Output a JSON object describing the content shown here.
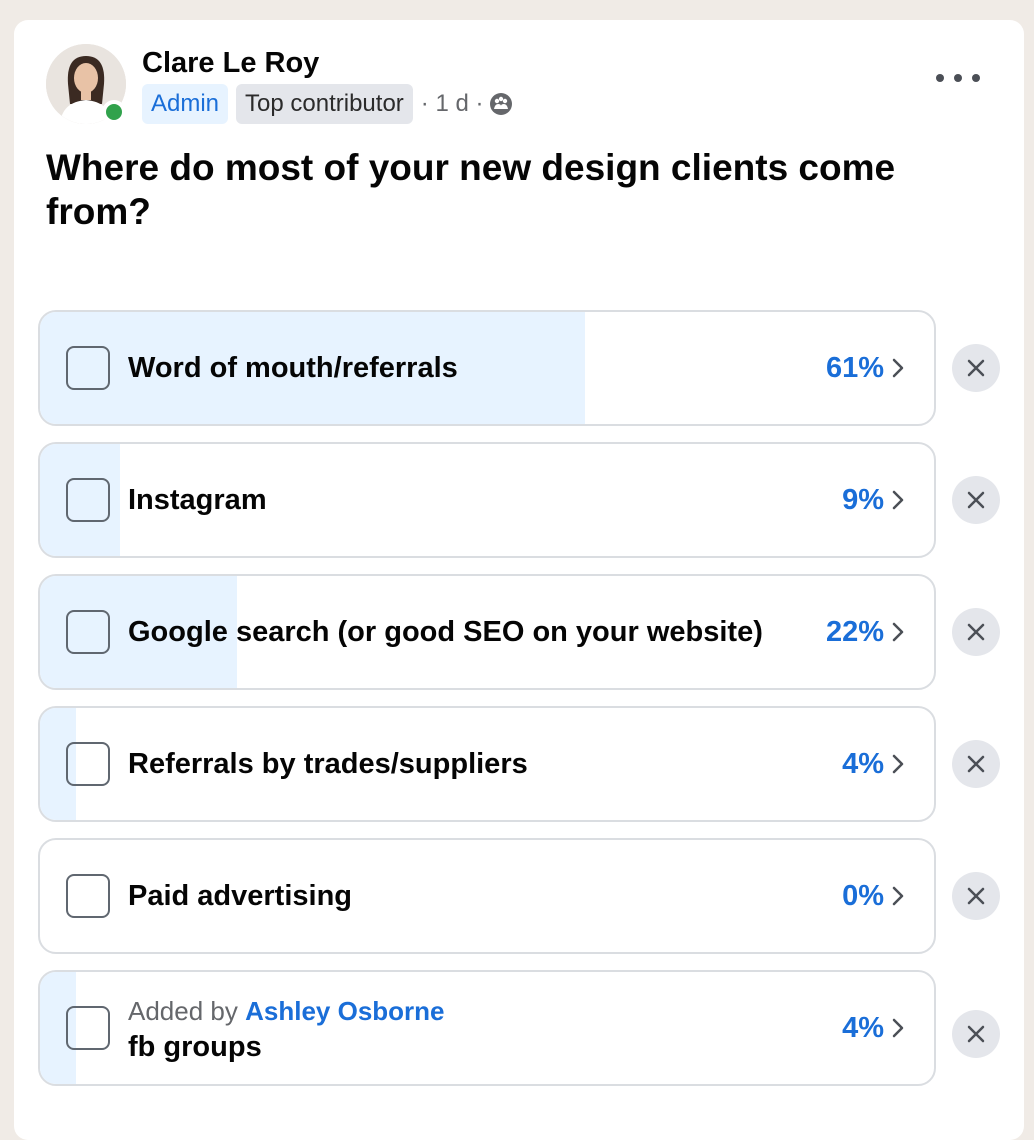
{
  "post": {
    "author": "Clare Le Roy",
    "badges": [
      "Admin",
      "Top contributor"
    ],
    "time": "· 1 d ·",
    "audience_icon": "group-icon",
    "question": "Where do most of your new design clients come from?"
  },
  "colors": {
    "accent": "#1a6ed8",
    "fill": "#e7f3ff",
    "online": "#31a24c",
    "card": "#ffffff",
    "page": "#f0ebe6"
  },
  "poll": {
    "options": [
      {
        "label": "Word of mouth/referrals",
        "percent": "61%",
        "value": 61
      },
      {
        "label": "Instagram",
        "percent": "9%",
        "value": 9
      },
      {
        "label": "Google search (or good SEO on your website)",
        "percent": "22%",
        "value": 22
      },
      {
        "label": "Referrals by trades/suppliers",
        "percent": "4%",
        "value": 4
      },
      {
        "label": "Paid advertising",
        "percent": "0%",
        "value": 0
      },
      {
        "added_by_prefix": "Added by",
        "added_by_name": "Ashley Osborne",
        "label": "fb groups",
        "percent": "4%",
        "value": 4
      }
    ]
  }
}
